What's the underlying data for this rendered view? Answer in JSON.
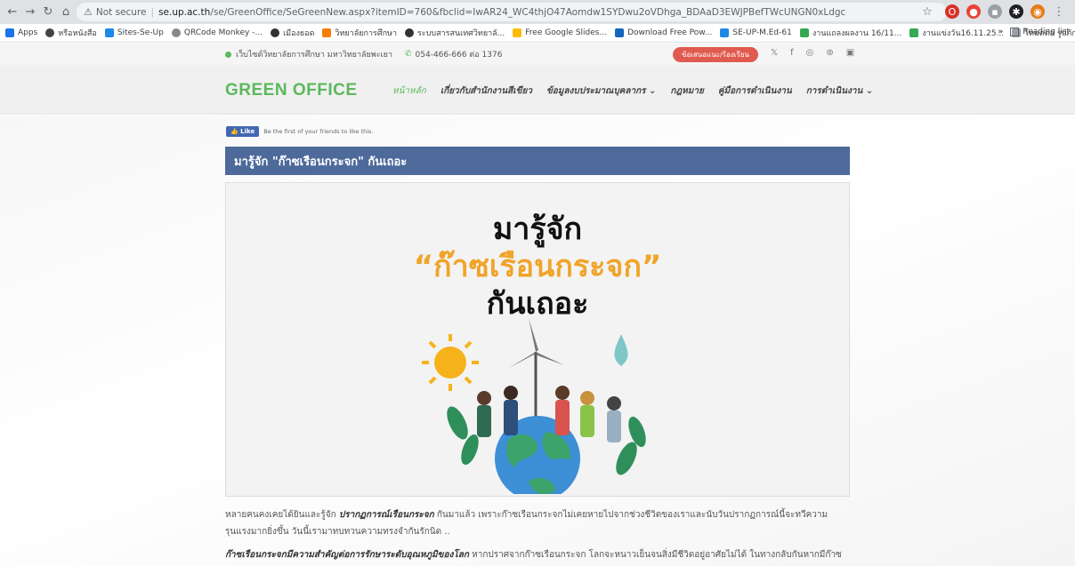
{
  "browser": {
    "address_warning": "Not secure",
    "url_host": "se.up.ac.th",
    "url_path": "/se/GreenOffice/SeGreenNew.aspx?itemID=760&fbclid=IwAR24_WC4thjO47Aomdw1SYDwu2oVDhga_BDAaD3EWJPBefTWcUNGN0xLdgc",
    "bookmarks": [
      "Apps",
      "หรือหนังสือ",
      "Sites-Se-Up",
      "QRCode Monkey -...",
      "เมืองยอด",
      "วิทยาลัยการศึกษา",
      "ระบบสารสนเทศวิทยาลั...",
      "Free Google Slides...",
      "Download Free Pow...",
      "SE-UP-M.Ed-61",
      "งานแถลงผลงาน 16/11...",
      "งานแข่งวัน16.11.25...",
      "โหมดต่อ รูปภักษณ์ยิ่ง..."
    ],
    "reading_list": "Reading list",
    "more_bookmarks": "»"
  },
  "topline": {
    "site_name": "เว็บไซต์วิทยาลัยการศึกษา มหาวิทยาลัยพะเยา",
    "phone": "054-466-666 ต่อ 1376",
    "cta": "ข้อเสนอแนะ/ร้องเรียน",
    "socials": [
      "𝕏",
      "f",
      "◎",
      "⊚",
      "▣"
    ]
  },
  "header": {
    "logo": "GREEN OFFICE",
    "nav": [
      {
        "label": "หน้าหลัก",
        "active": true
      },
      {
        "label": "เกี่ยวกับสำนักงานสีเขียว",
        "active": false
      },
      {
        "label": "ข้อมูลงบประมาณบุคลากร ⌄",
        "active": false
      },
      {
        "label": "กฎหมาย",
        "active": false
      },
      {
        "label": "คู่มือการดำเนินงาน",
        "active": false
      },
      {
        "label": "การดำเนินงาน ⌄",
        "active": false
      }
    ]
  },
  "fb": {
    "like_label": "Like",
    "text": "Be the first of your friends to like this."
  },
  "article": {
    "title": "มารู้จัก \"ก๊าซเรือนกระจก\" กันเถอะ",
    "poster_line1": "มารู้จัก",
    "poster_line2": "“ก๊าซเรือนกระจก”",
    "poster_line3": "กันเถอะ",
    "p1_a": "หลายคนคงเคยได้ยินและรู้จัก ",
    "p1_em": "ปรากฏการณ์เรือนกระจก",
    "p1_b": " กันมาแล้ว เพราะก๊าซเรือนกระจกไม่เคยหายไปจากช่วงชีวิตของเราและนับวันปรากฏการณ์นี้จะทวีความรุนแรงมากยิ่งขึ้น วันนี้เรามาทบทวนความทรงจำกันรักนิด ..",
    "p2_em": "ก๊าซเรือนกระจกมีความสำคัญต่อการรักษาระดับอุณหภูมิของโลก",
    "p2_b": " หากปราศจากก๊าซเรือนกระจก โลกจะหนาวเย็นจนสิ่งมีชีวิตอยู่อาศัยไม่ได้ ในทางกลับกันหากมีก๊าซ"
  },
  "colors": {
    "brand_green": "#5cb85c",
    "title_bar": "#4d6a9b",
    "cta_red": "#e05a4f",
    "poster_orange": "#f0a429"
  }
}
